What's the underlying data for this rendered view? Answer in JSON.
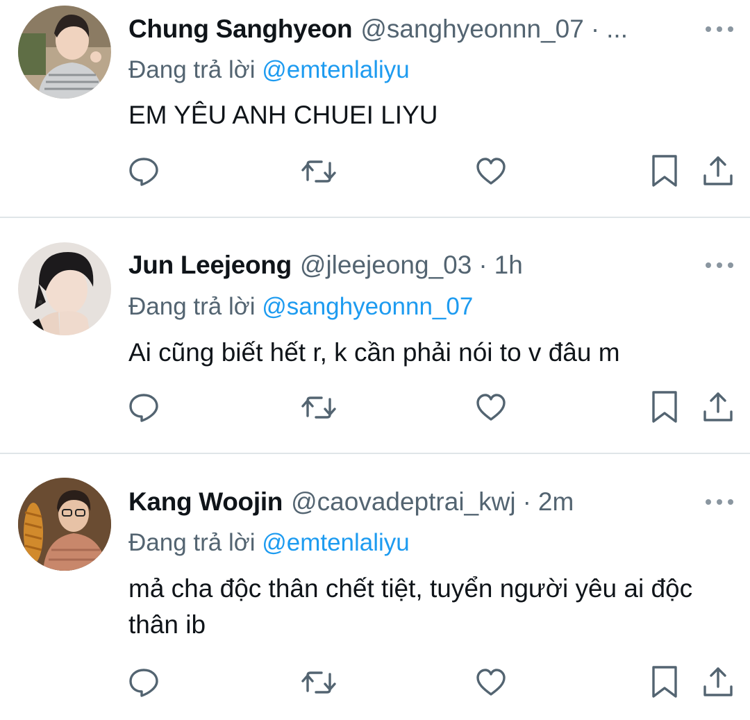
{
  "app": {
    "accent_color": "#1d9bf0",
    "text_color": "#0f1419",
    "muted_color": "#536471"
  },
  "icons": {
    "reply": "speech-bubble-icon",
    "retweet": "retweet-arrows-icon",
    "like": "heart-icon",
    "bookmark": "bookmark-icon",
    "share": "share-upload-icon",
    "more": "more-horizontal-icon"
  },
  "tweets": [
    {
      "display_name": "Chung Sanghyeon",
      "handle": "@sanghyeonnn_07",
      "separator": "·",
      "time": "...",
      "reply_prefix": "Đang trả lời",
      "reply_to": "@emtenlaliyu",
      "text": "EM YÊU ANH CHUEI LIYU"
    },
    {
      "display_name": "Jun Leejeong",
      "handle": "@jleejeong_03",
      "separator": "·",
      "time": "1h",
      "reply_prefix": "Đang trả lời",
      "reply_to": "@sanghyeonnn_07",
      "text": "Ai cũng biết hết r, k cần phải nói to v đâu m"
    },
    {
      "display_name": "Kang Woojin",
      "handle": "@caovadeptrai_kwj",
      "separator": "·",
      "time": "2m",
      "reply_prefix": "Đang trả lời",
      "reply_to": "@emtenlaliyu",
      "text": "mả cha độc thân chết tiệt, tuyển người yêu ai độc thân ib"
    }
  ]
}
